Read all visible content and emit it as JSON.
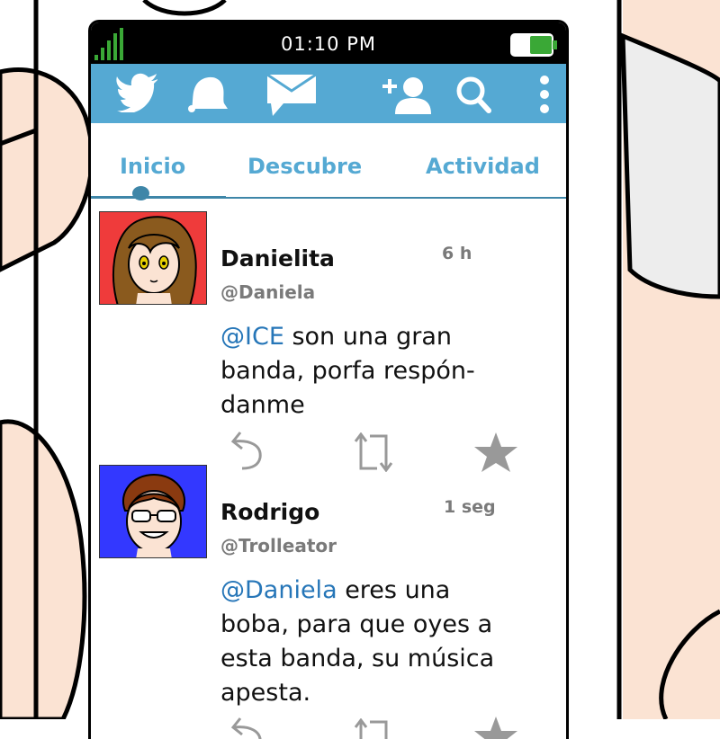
{
  "status": {
    "time": "01:10 PM"
  },
  "toolbar": {
    "icons": [
      "bird-icon",
      "notifications-icon",
      "messages-icon",
      "add-user-icon",
      "search-icon",
      "more-icon"
    ]
  },
  "tabs": [
    {
      "label": "Inicio",
      "active": true
    },
    {
      "label": "Descubre",
      "active": false
    },
    {
      "label": "Actividad",
      "active": false
    }
  ],
  "tweets": [
    {
      "name": "Danielita",
      "handle": "@Daniela",
      "time": "6 h",
      "mention": "@ICE",
      "line1_rest": " son una gran",
      "line2": "banda, porfa respón-",
      "line3": "danme",
      "avatar_bg": "#ef3b3b"
    },
    {
      "name": "Rodrigo",
      "handle": "@Trolleator",
      "time": "1 seg",
      "mention": "@Daniela",
      "line1_rest": " eres una",
      "line2": "boba, para que oyes a",
      "line3": "esta banda, su música",
      "line4": "apesta.",
      "avatar_bg": "#3338ff"
    }
  ],
  "colors": {
    "accent": "#55a9d3",
    "tab_line": "#3e86a8",
    "mention": "#2676b8",
    "skin": "#fbe3d3"
  }
}
